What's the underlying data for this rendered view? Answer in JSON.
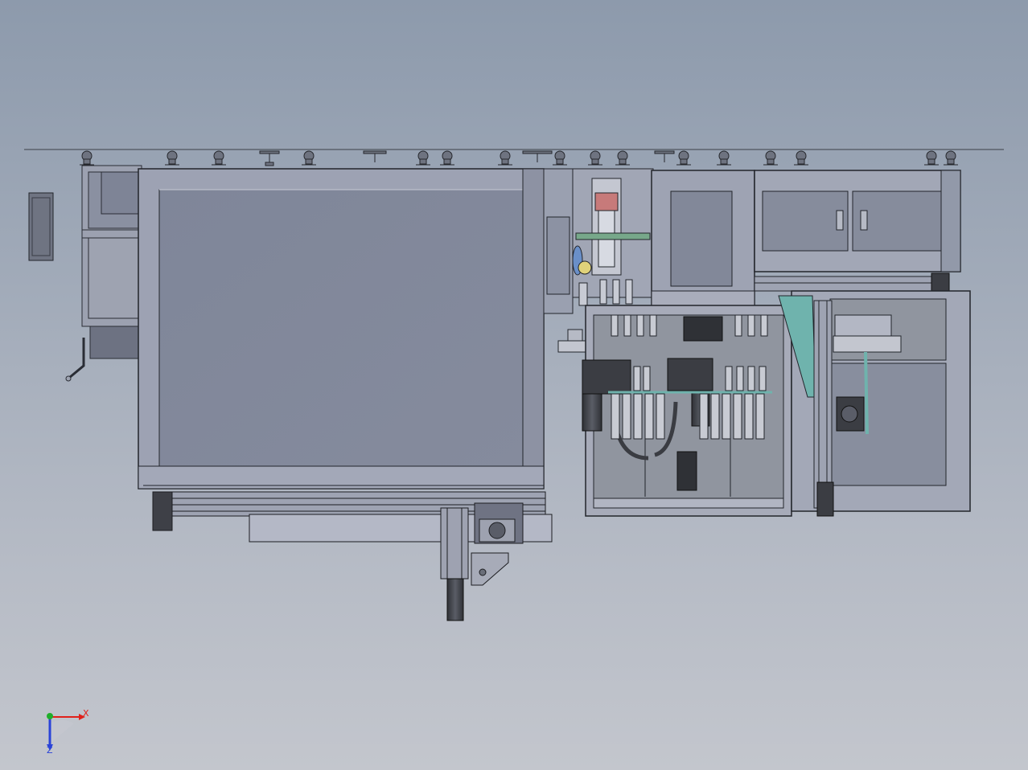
{
  "view": {
    "background_top": "#8d9aac",
    "background_bottom": "#c3c6cd"
  },
  "colors": {
    "panel": "#7d8496",
    "panel_light": "#8a90a2",
    "frame": "#9aa0b2",
    "outline": "#2a2d35",
    "dark_part": "#3a3c42",
    "teal": "#6fb3ad",
    "red_part": "#c77a7a",
    "axis_x": "#e0201a",
    "axis_y": "#1fae2a",
    "axis_z": "#2a43d8"
  },
  "icons": {
    "triad": "coordinate-triad-icon"
  },
  "triad": {
    "x_label": "X",
    "z_label": "Z"
  }
}
